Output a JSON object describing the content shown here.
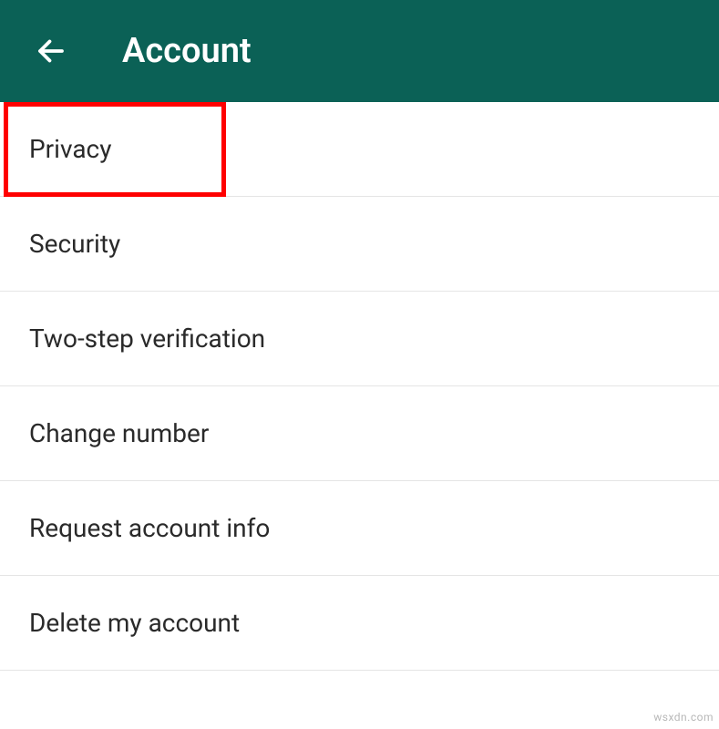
{
  "header": {
    "title": "Account"
  },
  "items": [
    {
      "label": "Privacy"
    },
    {
      "label": "Security"
    },
    {
      "label": "Two-step verification"
    },
    {
      "label": "Change number"
    },
    {
      "label": "Request account info"
    },
    {
      "label": "Delete my account"
    }
  ],
  "watermark": "wsxdn.com"
}
